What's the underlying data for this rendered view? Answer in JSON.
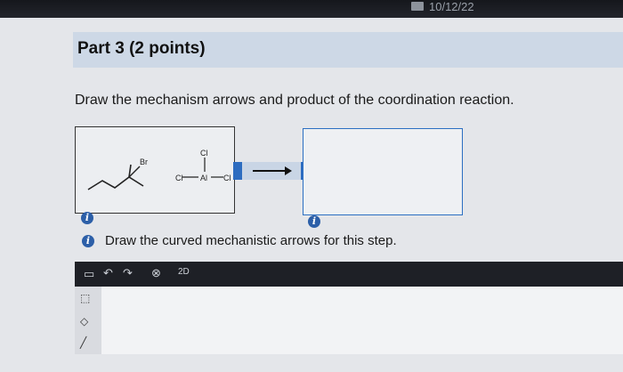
{
  "header": {
    "date": "10/12/22"
  },
  "part": {
    "title": "Part 3  (2 points)"
  },
  "question": {
    "instruction": "Draw the mechanism arrows and product of the coordination reaction."
  },
  "hint": {
    "text": "Draw the curved mechanistic arrows for this step."
  },
  "reactants": {
    "alkyl_halide_label": "Br",
    "lewis_acid_center": "Al",
    "lewis_acid_ligand": "Cl"
  },
  "toolbar": {
    "items": [
      "new-doc-icon",
      "undo-icon",
      "redo-icon",
      "clear-icon",
      "2d-template-icon"
    ],
    "template_label": "2D"
  },
  "side_tools": {
    "items": [
      "select-icon",
      "eraser-icon",
      "bond-icon"
    ]
  },
  "colors": {
    "accent": "#2d6cc0",
    "band": "#cdd8e6",
    "info": "#2c5fa8"
  }
}
